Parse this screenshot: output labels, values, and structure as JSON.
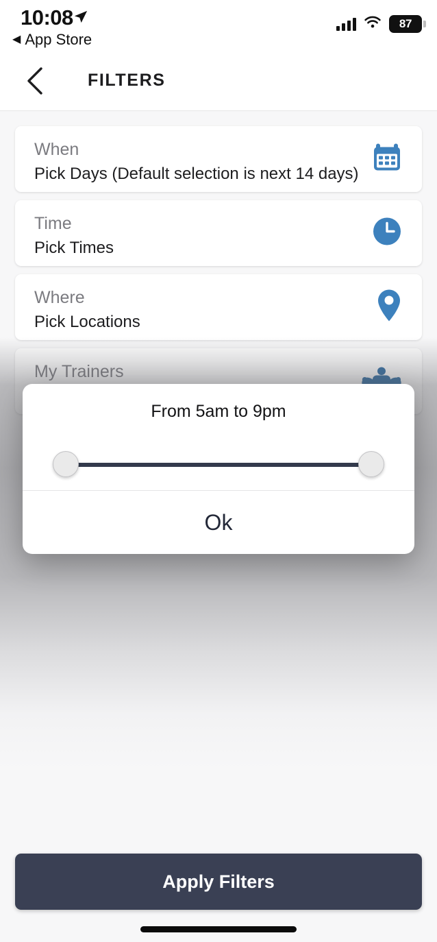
{
  "status_bar": {
    "time": "10:08",
    "return_app_label": "App Store",
    "return_arrow": "◀",
    "location_icon": "location-arrow-icon",
    "signal_icon": "cellular-signal-icon",
    "wifi_icon": "wifi-icon",
    "battery_percent": "87"
  },
  "header": {
    "title": "FILTERS",
    "back_icon": "chevron-left-icon"
  },
  "filters": [
    {
      "title": "When",
      "subtitle": "Pick Days (Default selection is next 14 days)",
      "icon": "calendar-icon"
    },
    {
      "title": "Time",
      "subtitle": "Pick Times",
      "icon": "clock-icon"
    },
    {
      "title": "Where",
      "subtitle": "Pick Locations",
      "icon": "map-pin-icon"
    },
    {
      "title": "My Trainers",
      "subtitle": "",
      "icon": "bodybuilder-icon"
    }
  ],
  "time_modal": {
    "title": "From 5am to 9pm",
    "range_start_label": "5am",
    "range_end_label": "9pm",
    "slider": {
      "min_handle_position_percent": 0,
      "max_handle_position_percent": 100
    },
    "ok_label": "Ok"
  },
  "footer": {
    "apply_label": "Apply Filters",
    "home_indicator": "home-indicator"
  },
  "colors": {
    "accent_blue": "#3d81bd",
    "dark_navy": "#3a4054",
    "track": "#333a4c",
    "page_bg": "#f7f7f8",
    "card_bg": "#ffffff",
    "title_gray": "#7b7b80"
  }
}
